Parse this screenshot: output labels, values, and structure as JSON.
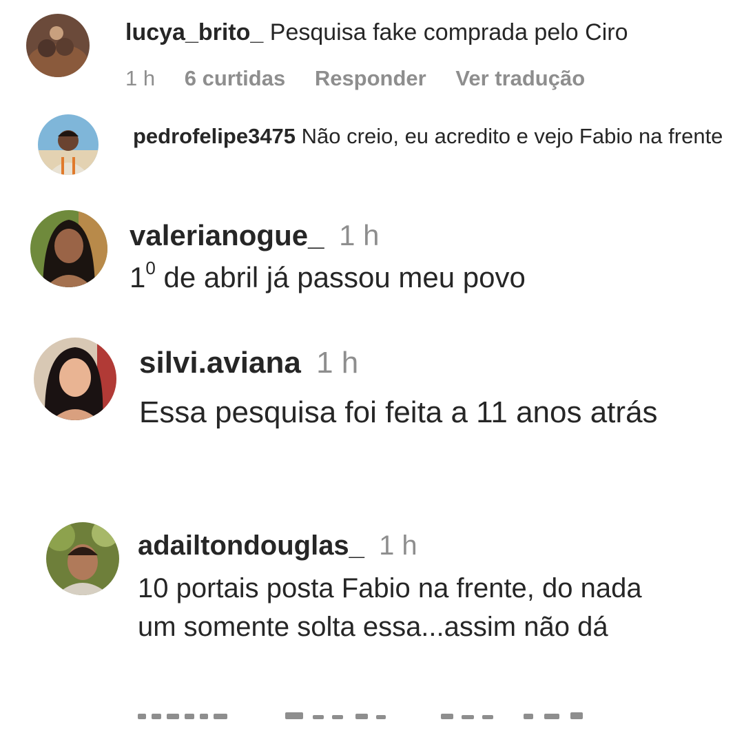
{
  "comments": [
    {
      "username": "lucya_brito_",
      "text": "Pesquisa fake comprada pelo Ciro",
      "time": "1 h",
      "likes": "6 curtidas",
      "reply": "Responder",
      "translate": "Ver tradução"
    },
    {
      "username": "pedrofelipe3475",
      "text": "Não creio, eu acredito e vejo Fabio na frente"
    },
    {
      "username": "valerianogue_",
      "time": "1 h",
      "text_main": "1",
      "text_sup": "0",
      "text_rest": " de abril já passou meu povo"
    },
    {
      "username": "silvi.aviana",
      "time": "1 h",
      "text": "Essa pesquisa foi feita a 11 anos atrás"
    },
    {
      "username": "adailtondouglas_",
      "time": "1 h",
      "text": "10 portais posta Fabio na frente, do nada um somente solta essa...assim não dá"
    }
  ]
}
